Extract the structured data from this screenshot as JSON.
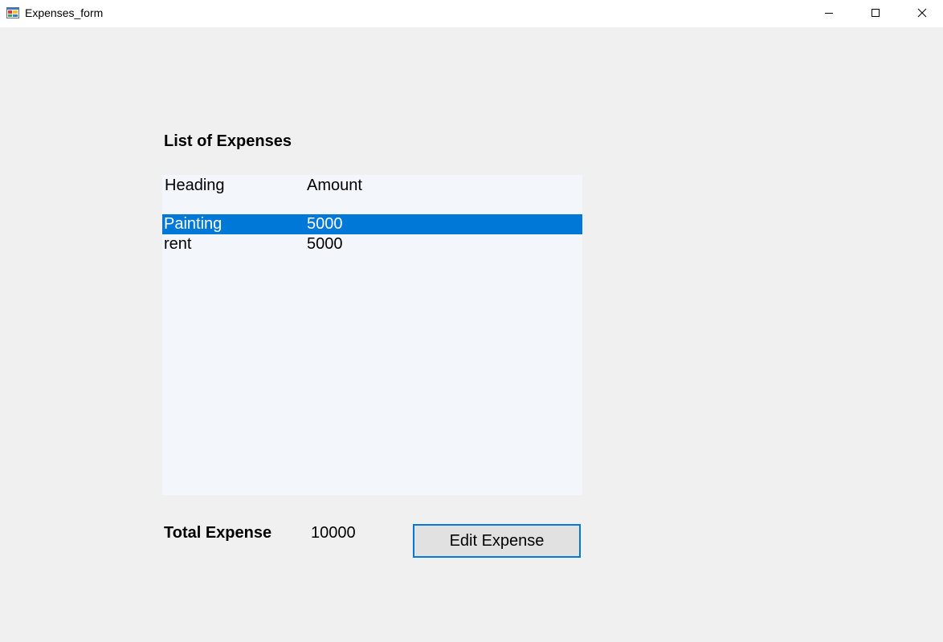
{
  "window": {
    "title": "Expenses_form",
    "icon": "winforms-app-icon",
    "controls": [
      "minimize-icon",
      "maximize-icon",
      "close-icon"
    ]
  },
  "list": {
    "title": "List of Expenses",
    "columns": [
      "Heading",
      "Amount"
    ],
    "rows": [
      {
        "heading": "Painting",
        "amount": "5000",
        "selected": true
      },
      {
        "heading": "rent",
        "amount": "5000",
        "selected": false
      }
    ]
  },
  "total": {
    "label": "Total Expense",
    "value": "10000"
  },
  "actions": {
    "edit_label": "Edit Expense"
  },
  "colors": {
    "selection": "#0078d7",
    "list_background": "#f3f6fa",
    "form_background": "#f0f0f0",
    "button_border": "#0078d7"
  }
}
